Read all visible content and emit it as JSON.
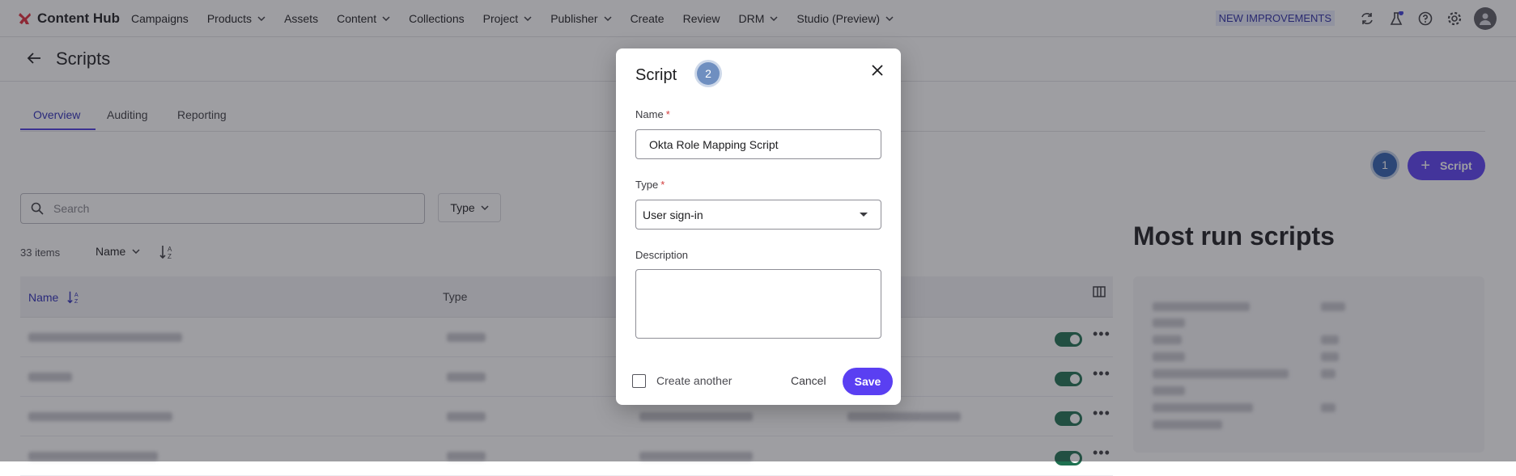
{
  "brand": {
    "name": "Content Hub"
  },
  "nav": {
    "items": [
      {
        "label": "Campaigns",
        "dropdown": false
      },
      {
        "label": "Products",
        "dropdown": true
      },
      {
        "label": "Assets",
        "dropdown": false
      },
      {
        "label": "Content",
        "dropdown": true
      },
      {
        "label": "Collections",
        "dropdown": false
      },
      {
        "label": "Project",
        "dropdown": true
      },
      {
        "label": "Publisher",
        "dropdown": true
      },
      {
        "label": "Create",
        "dropdown": false
      },
      {
        "label": "Review",
        "dropdown": false
      },
      {
        "label": "DRM",
        "dropdown": true
      },
      {
        "label": "Studio (Preview)",
        "dropdown": true
      }
    ],
    "badge": "NEW IMPROVEMENTS",
    "icons": [
      "sync-icon",
      "flask-icon",
      "help-icon",
      "settings-icon",
      "user-avatar"
    ]
  },
  "page": {
    "title": "Scripts",
    "tabs": [
      "Overview",
      "Auditing",
      "Reporting"
    ],
    "active_tab": "Overview",
    "add_button_label": "Script",
    "step_marker_1": "1",
    "search_placeholder": "Search",
    "type_filter_label": "Type",
    "item_count": "33 items",
    "sort_field": "Name",
    "table": {
      "columns": [
        "Name",
        "Type"
      ]
    },
    "most_run_title": "Most run scripts"
  },
  "modal": {
    "title": "Script",
    "step_marker_2": "2",
    "name_label": "Name",
    "name_value": "Okta Role Mapping Script",
    "type_label": "Type",
    "type_value": "User sign-in",
    "description_label": "Description",
    "description_value": "",
    "required_mark": "*",
    "create_another_label": "Create another",
    "create_another_checked": false,
    "cancel_label": "Cancel",
    "save_label": "Save"
  },
  "colors": {
    "primary": "#5a3ff2",
    "active_tab": "#2c2cb8",
    "toggle_on": "#1e7050",
    "required": "#d23b3b",
    "step_marker": "#2f5fb0"
  }
}
